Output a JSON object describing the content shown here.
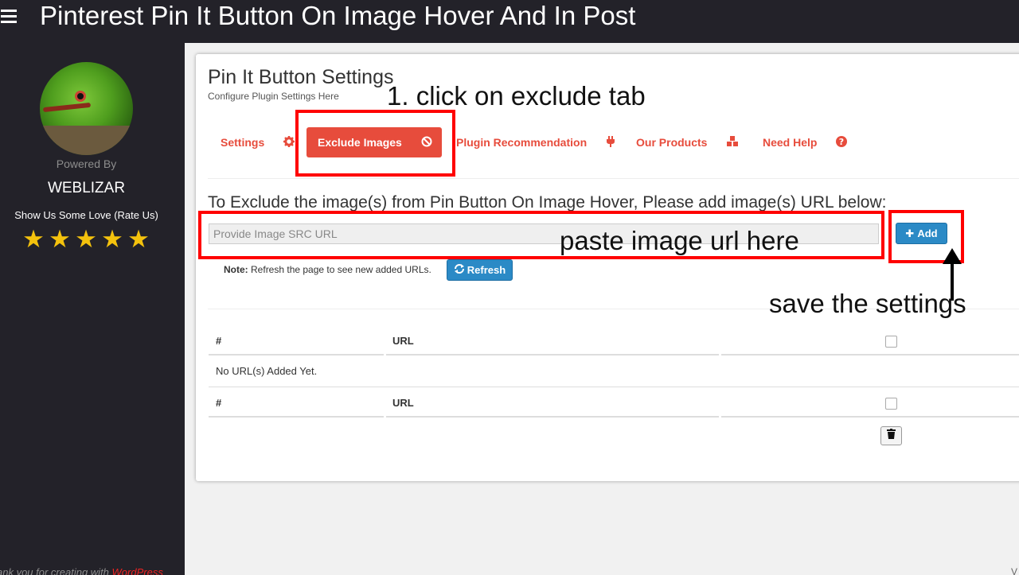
{
  "header": {
    "title": "Pinterest Pin It Button On Image Hover And In Post"
  },
  "sidebar": {
    "powered_by": "Powered By",
    "brand": "WEBLIZAR",
    "rate": "Show Us Some Love (Rate Us)",
    "stars": 5,
    "footer_prefix": "ank you for creating with",
    "footer_link": "WordPress",
    "version": "V"
  },
  "panel": {
    "title": "Pin It Button Settings",
    "subtitle": "Configure Plugin Settings Here",
    "tabs": [
      {
        "label": "Settings",
        "icon": "gear-icon"
      },
      {
        "label": "Exclude Images",
        "icon": "ban-icon",
        "active": true
      },
      {
        "label": "Plugin Recommendation",
        "icon": "plug-icon"
      },
      {
        "label": "Our Products",
        "icon": "cubes-icon"
      },
      {
        "label": "Need Help",
        "icon": "question-icon"
      }
    ],
    "exclude_heading": "To Exclude the image(s) from Pin Button On Image Hover, Please add image(s) URL below:",
    "input_placeholder": "Provide Image SRC URL",
    "add_label": "Add",
    "note_label": "Note:",
    "note_text": "Refresh the page to see new added URLs.",
    "refresh_label": "Refresh",
    "table": {
      "col_num": "#",
      "col_url": "URL",
      "empty": "No URL(s) Added Yet."
    }
  },
  "annotations": {
    "step1": "1. click on exclude tab",
    "paste": "paste image url here",
    "save": "save the settings"
  },
  "colors": {
    "accent": "#e74c3c",
    "button": "#2b8ac6",
    "dark": "#232229",
    "annotation": "#ff0000"
  }
}
